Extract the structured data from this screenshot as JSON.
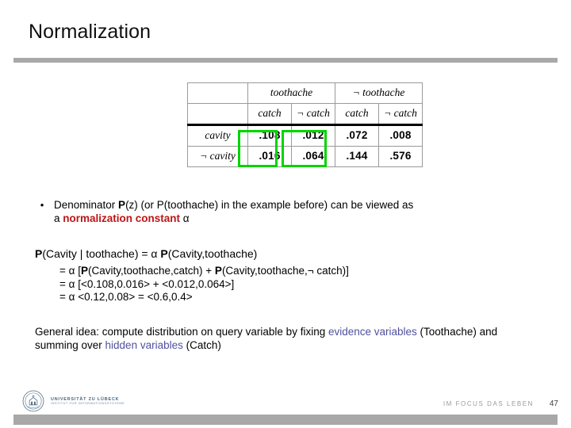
{
  "slide": {
    "title": "Normalization",
    "page_number": "47"
  },
  "table": {
    "corner": "",
    "col_groups": [
      "toothache",
      "¬ toothache"
    ],
    "sub_headers": [
      "catch",
      "¬ catch",
      "catch",
      "¬ catch"
    ],
    "row_labels": [
      "cavity",
      "¬ cavity"
    ],
    "rows": [
      [
        ".108",
        ".012",
        ".072",
        ".008"
      ],
      [
        ".016",
        ".064",
        ".144",
        ".576"
      ]
    ],
    "highlight_color": "#00d400",
    "highlighted_columns": [
      "catch",
      "¬ catch"
    ]
  },
  "bullet": {
    "marker": "•",
    "line1_a": "Denominator ",
    "line1_bold_p": "P",
    "line1_b": "(z) (or P(toothache) in the example before) can be viewed as",
    "line2_a": "a ",
    "line2_red": "normalization constant",
    "line2_b": " α"
  },
  "equation": {
    "main_bold_p1": "P",
    "main_part1": "(Cavity | toothache) = α ",
    "main_bold_p2": "P",
    "main_part2": "(Cavity,toothache)",
    "line1_pre": "= α [",
    "line1_p1": "P",
    "line1_mid": "(Cavity,toothache,catch) + ",
    "line1_p2": "P",
    "line1_post": "(Cavity,toothache,¬ catch)]",
    "line2": "= α [<0.108,0.016> + <0.012,0.064>]",
    "line3": "= α <0.12,0.08> = <0.6,0.4>"
  },
  "general_idea": {
    "part1": "General idea: compute distribution on query variable by fixing ",
    "blue1": "evidence variables",
    "part2": " (Toothache) and summing over ",
    "blue2": "hidden variables",
    "part3": " (Catch)"
  },
  "footer": {
    "university_name": "UNIVERSITÄT ZU LÜBECK",
    "university_sub": "INSTITUT FÜR INFORMATIONSSYSTEME",
    "slogan": "IM FOCUS DAS LEBEN"
  },
  "colors": {
    "rule": "#a8a8a8",
    "red": "#bd1515",
    "blue": "#50509e",
    "green": "#00d400"
  }
}
